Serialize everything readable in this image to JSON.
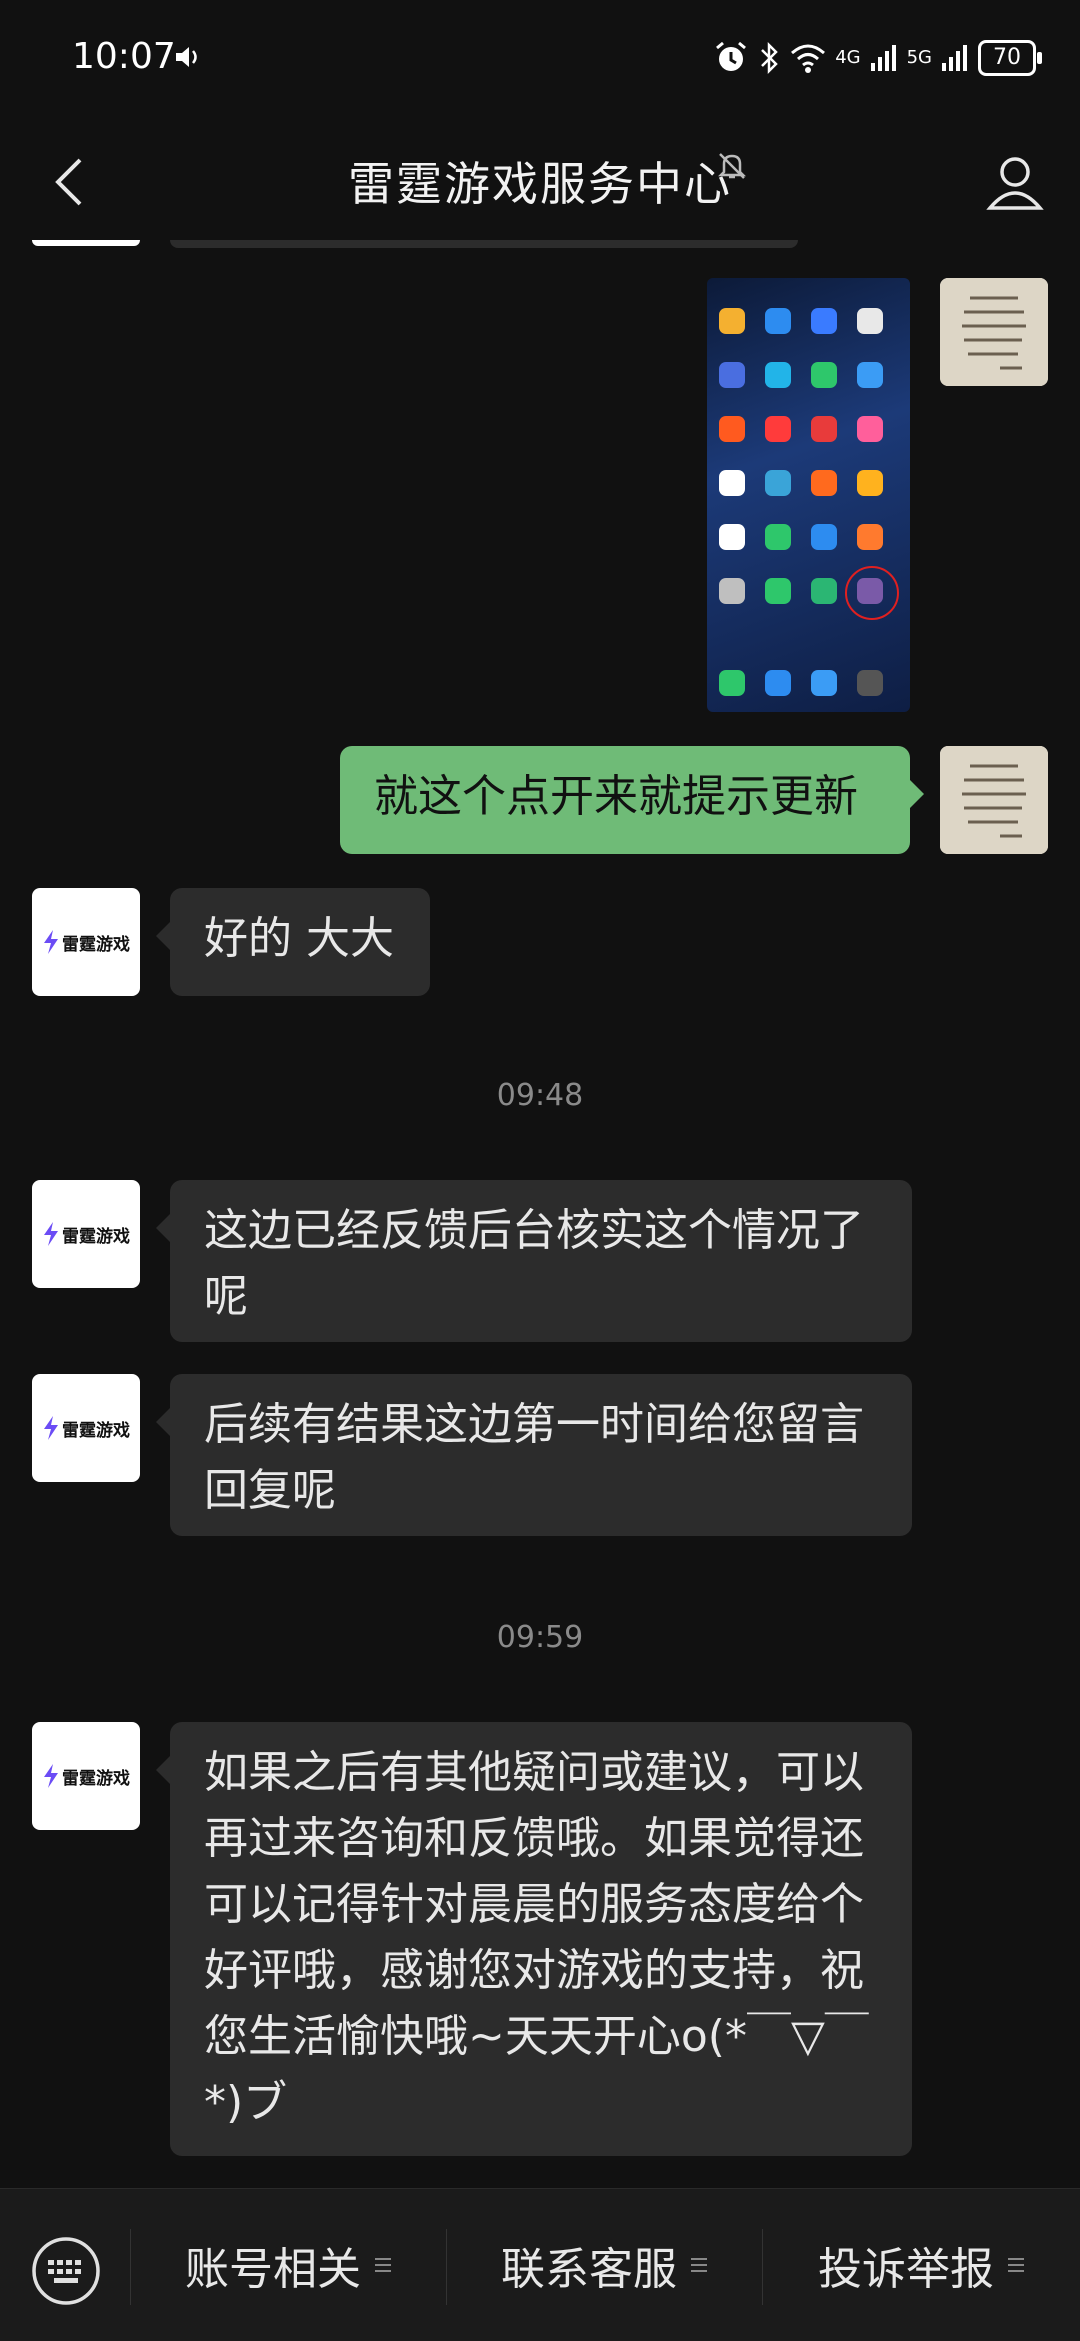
{
  "status_bar": {
    "time": "10:07",
    "network_1": "4G",
    "network_2": "5G",
    "battery": "70"
  },
  "header": {
    "title": "雷霆游戏服务中心"
  },
  "messages": [
    {
      "from": "me",
      "type": "image",
      "description_alt": "phone home screen"
    },
    {
      "from": "me",
      "text": "就这个点开来就提示更新"
    },
    {
      "from": "service",
      "text": "好的 大大"
    },
    {
      "type": "time",
      "text": "09:48"
    },
    {
      "from": "service",
      "text": "这边已经反馈后台核实这个情况了呢"
    },
    {
      "from": "service",
      "text": "后续有结果这边第一时间给您留言回复呢"
    },
    {
      "type": "time",
      "text": "09:59"
    },
    {
      "from": "service",
      "text": "如果之后有其他疑问或建议，可以再过来咨询和反馈哦。如果觉得还可以记得针对晨晨的服务态度给个好评哦，感谢您对游戏的支持，祝您生活愉快哦~天天开心o(*￣▽￣*)ブ"
    }
  ],
  "brand": {
    "avatar_text": "雷霆游戏"
  },
  "menu": {
    "items": [
      {
        "label": "账号相关"
      },
      {
        "label": "联系客服"
      },
      {
        "label": "投诉举报"
      }
    ]
  },
  "colors": {
    "background": "#111111",
    "incoming_bubble": "#2c2c2c",
    "outgoing_bubble": "#6fbb77",
    "menu_bar": "#1b1b1b"
  }
}
